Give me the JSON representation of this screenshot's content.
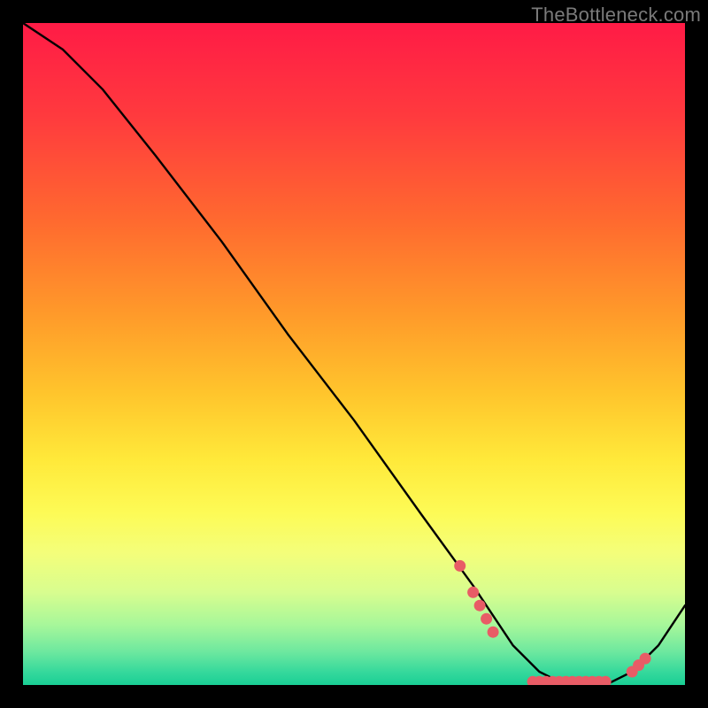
{
  "watermark": "TheBottleneck.com",
  "chart_data": {
    "type": "line",
    "title": "",
    "xlabel": "",
    "ylabel": "",
    "xlim": [
      0,
      100
    ],
    "ylim": [
      0,
      100
    ],
    "curve_bottleneck_percent": [
      {
        "x": 0,
        "y": 100
      },
      {
        "x": 6,
        "y": 96
      },
      {
        "x": 12,
        "y": 90
      },
      {
        "x": 20,
        "y": 80
      },
      {
        "x": 30,
        "y": 67
      },
      {
        "x": 40,
        "y": 53
      },
      {
        "x": 50,
        "y": 40
      },
      {
        "x": 60,
        "y": 26
      },
      {
        "x": 68,
        "y": 15
      },
      {
        "x": 74,
        "y": 6
      },
      {
        "x": 78,
        "y": 2
      },
      {
        "x": 82,
        "y": 0
      },
      {
        "x": 88,
        "y": 0
      },
      {
        "x": 92,
        "y": 2
      },
      {
        "x": 96,
        "y": 6
      },
      {
        "x": 100,
        "y": 12
      }
    ],
    "marker_points_percent": [
      {
        "x": 66,
        "y": 18
      },
      {
        "x": 68,
        "y": 14
      },
      {
        "x": 69,
        "y": 12
      },
      {
        "x": 70,
        "y": 10
      },
      {
        "x": 71,
        "y": 8
      },
      {
        "x": 77,
        "y": 0.5
      },
      {
        "x": 78,
        "y": 0.5
      },
      {
        "x": 79,
        "y": 0.5
      },
      {
        "x": 80,
        "y": 0.5
      },
      {
        "x": 81,
        "y": 0.5
      },
      {
        "x": 82,
        "y": 0.5
      },
      {
        "x": 83,
        "y": 0.5
      },
      {
        "x": 84,
        "y": 0.5
      },
      {
        "x": 85,
        "y": 0.5
      },
      {
        "x": 86,
        "y": 0.5
      },
      {
        "x": 87,
        "y": 0.5
      },
      {
        "x": 88,
        "y": 0.5
      },
      {
        "x": 92,
        "y": 2
      },
      {
        "x": 93,
        "y": 3
      },
      {
        "x": 94,
        "y": 4
      }
    ],
    "colors": {
      "curve": "#000000",
      "marker": "#e85c66"
    }
  }
}
